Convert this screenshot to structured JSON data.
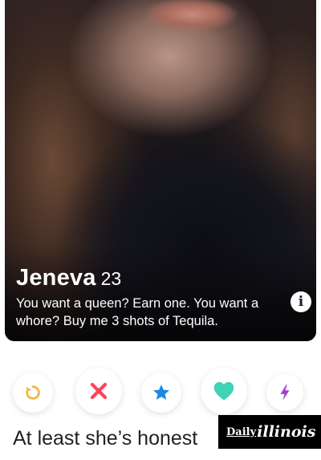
{
  "profile": {
    "name": "Jeneva",
    "age": "23",
    "bio": "You want a queen? Earn one. You want a whore? Buy me 3 shots of Tequila.",
    "info_icon": "i"
  },
  "actions": {
    "rewind_icon": "rewind-icon",
    "nope_icon": "x-icon",
    "superlike_icon": "star-icon",
    "like_icon": "heart-icon",
    "boost_icon": "lightning-icon",
    "colors": {
      "rewind": "#f5b748",
      "nope": "#ff4458",
      "superlike": "#1e88e5",
      "like": "#3ed3b4",
      "boost": "#a53bd3"
    }
  },
  "caption": {
    "text": "At least she’s honest"
  },
  "branding": {
    "daily": "Daily",
    "illinois": "illinois"
  }
}
